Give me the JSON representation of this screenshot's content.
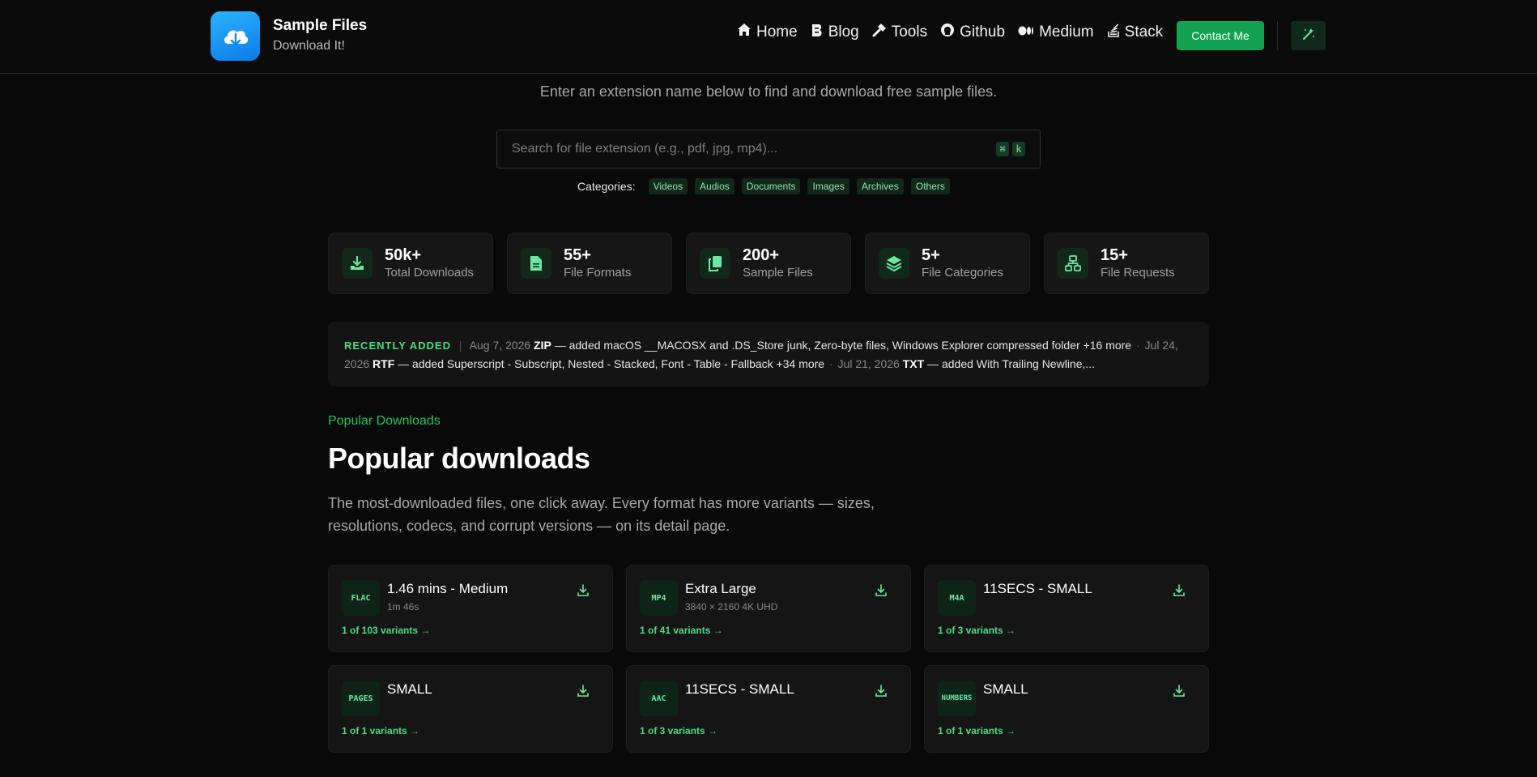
{
  "header": {
    "brand_title": "Sample Files",
    "brand_subtitle": "Download It!",
    "nav": [
      {
        "label": "Home",
        "icon": "home-icon"
      },
      {
        "label": "Blog",
        "icon": "blog-icon"
      },
      {
        "label": "Tools",
        "icon": "hammer-icon"
      },
      {
        "label": "Github",
        "icon": "github-icon"
      },
      {
        "label": "Medium",
        "icon": "medium-icon"
      },
      {
        "label": "Stack",
        "icon": "stack-icon"
      }
    ],
    "contact_label": "Contact Me",
    "theme_icon": "magic-wand-icon"
  },
  "search": {
    "subtitle": "Enter an extension name below to find and download free sample files.",
    "placeholder": "Search for file extension (e.g., pdf, jpg, mp4)...",
    "shortcut_keys": [
      "⌘",
      "k"
    ],
    "categories_label": "Categories:",
    "categories": [
      "Videos",
      "Audios",
      "Documents",
      "Images",
      "Archives",
      "Others"
    ]
  },
  "stats": [
    {
      "value": "50k+",
      "label": "Total Downloads",
      "icon": "download-tray-icon"
    },
    {
      "value": "55+",
      "label": "File Formats",
      "icon": "file-icon"
    },
    {
      "value": "200+",
      "label": "Sample Files",
      "icon": "copy-files-icon"
    },
    {
      "value": "5+",
      "label": "File Categories",
      "icon": "layers-icon"
    },
    {
      "value": "15+",
      "label": "File Requests",
      "icon": "sitemap-icon"
    }
  ],
  "recent": {
    "tag": "RECENTLY ADDED",
    "items": [
      {
        "date": "Aug 7, 2026",
        "ext": "ZIP",
        "text": "— added macOS __MACOSX and .DS_Store junk, Zero-byte files, Windows Explorer compressed folder +16 more"
      },
      {
        "date": "Jul 24, 2026",
        "ext": "RTF",
        "text": "— added Superscript - Subscript, Nested - Stacked, Font - Table - Fallback +34 more"
      },
      {
        "date": "Jul 21, 2026",
        "ext": "TXT",
        "text": "— added With Trailing Newline,..."
      }
    ]
  },
  "popular": {
    "eyebrow": "Popular Downloads",
    "title": "Popular downloads",
    "description": "The most-downloaded files, one click away. Every format has more variants — sizes, resolutions, codecs, and corrupt versions — on its detail page.",
    "cards": [
      {
        "badge": "FLAC",
        "title": "1.46 mins - Medium",
        "subtitle": "1m 46s",
        "variants": "1 of 103 variants →"
      },
      {
        "badge": "MP4",
        "title": "Extra Large",
        "subtitle": "3840 × 2160 4K UHD",
        "variants": "1 of 41 variants →"
      },
      {
        "badge": "M4A",
        "title": "11SECS - SMALL",
        "subtitle": "",
        "variants": "1 of 3 variants →"
      },
      {
        "badge": "PAGES",
        "title": "SMALL",
        "subtitle": "",
        "variants": "1 of 1 variants →"
      },
      {
        "badge": "AAC",
        "title": "11SECS - SMALL",
        "subtitle": "",
        "variants": "1 of 3 variants →"
      },
      {
        "badge": "NUMBERS",
        "title": "SMALL",
        "subtitle": "",
        "variants": "1 of 1 variants →"
      }
    ]
  },
  "colors": {
    "accent": "#22c55e",
    "button": "#12a150",
    "background": "#090909",
    "card": "#151515",
    "logo_gradient_start": "#2ab4ff",
    "logo_gradient_end": "#0c7ae8"
  }
}
